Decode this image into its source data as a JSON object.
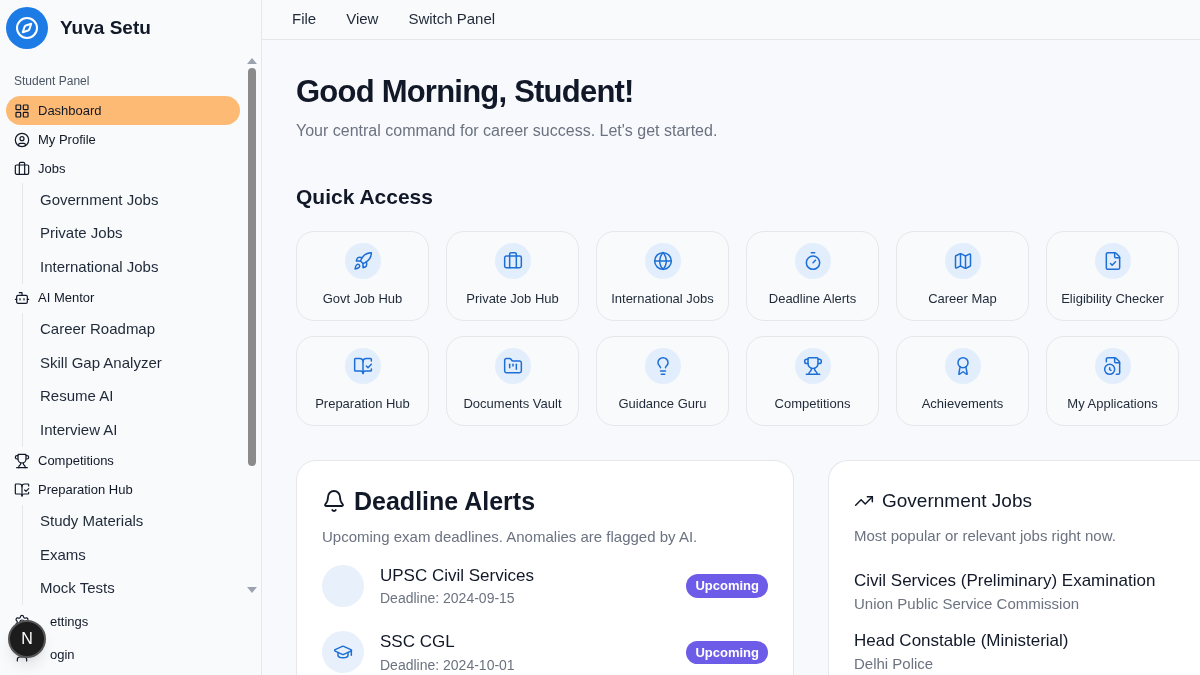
{
  "brand": {
    "name": "Yuva Setu"
  },
  "sidebar": {
    "section": "Student Panel",
    "items": [
      {
        "kind": "link",
        "label": "Dashboard",
        "selected": true
      },
      {
        "kind": "link",
        "label": "My Profile",
        "selected": false
      },
      {
        "kind": "group",
        "label": "Jobs",
        "selected": false,
        "children": [
          {
            "label": "Government Jobs"
          },
          {
            "label": "Private Jobs"
          },
          {
            "label": "International Jobs"
          }
        ]
      },
      {
        "kind": "group",
        "label": "AI Mentor",
        "selected": false,
        "children": [
          {
            "label": "Career Roadmap"
          },
          {
            "label": "Skill Gap Analyzer"
          },
          {
            "label": "Resume AI"
          },
          {
            "label": "Interview AI"
          }
        ]
      },
      {
        "kind": "link",
        "label": "Competitions",
        "selected": false
      },
      {
        "kind": "group",
        "label": "Preparation Hub",
        "selected": false,
        "children": [
          {
            "label": "Study Materials"
          },
          {
            "label": "Exams"
          },
          {
            "label": "Mock Tests"
          }
        ]
      }
    ],
    "footer": [
      {
        "label": "ettings"
      },
      {
        "label": "ogin"
      }
    ]
  },
  "dev_badge": "N",
  "menu": [
    "File",
    "View",
    "Switch Panel"
  ],
  "greeting": {
    "title": "Good Morning, Student!",
    "subtitle": "Your central command for career success. Let's get started."
  },
  "quick_access": {
    "title": "Quick Access",
    "tiles": [
      {
        "label": "Govt Job Hub"
      },
      {
        "label": "Private Job Hub"
      },
      {
        "label": "International Jobs"
      },
      {
        "label": "Deadline Alerts"
      },
      {
        "label": "Career Map"
      },
      {
        "label": "Eligibility Checker"
      },
      {
        "label": "Preparation Hub"
      },
      {
        "label": "Documents Vault"
      },
      {
        "label": "Guidance Guru"
      },
      {
        "label": "Competitions"
      },
      {
        "label": "Achievements"
      },
      {
        "label": "My Applications"
      }
    ]
  },
  "deadline_alerts": {
    "title": "Deadline Alerts",
    "subtitle": "Upcoming exam deadlines. Anomalies are flagged by AI.",
    "items": [
      {
        "name": "UPSC Civil Services",
        "deadline": "Deadline: 2024-09-15",
        "status": "Upcoming"
      },
      {
        "name": "SSC CGL",
        "deadline": "Deadline: 2024-10-01",
        "status": "Upcoming"
      }
    ]
  },
  "government_jobs": {
    "title": "Government Jobs",
    "subtitle": "Most popular or relevant jobs right now.",
    "items": [
      {
        "title": "Civil Services (Preliminary) Examination",
        "org": "Union Public Service Commission"
      },
      {
        "title": "Head Constable (Ministerial)",
        "org": "Delhi Police"
      }
    ]
  }
}
